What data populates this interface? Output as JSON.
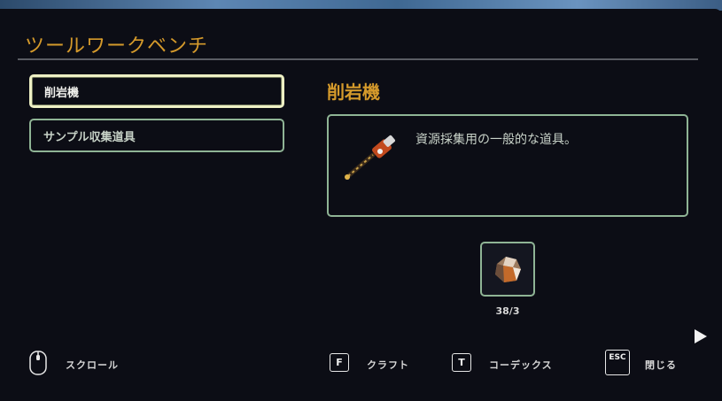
{
  "window": {
    "title": "ツールワークベンチ"
  },
  "recipes": [
    {
      "label": "削岩機"
    },
    {
      "label": "サンプル収集道具"
    }
  ],
  "details": {
    "name": "削岩機",
    "description": "資源採集用の一般的な道具。",
    "icon": "drill-icon"
  },
  "ingredients": [
    {
      "icon": "ore-icon",
      "count": "38/3"
    }
  ],
  "hints": {
    "scroll": {
      "icon": "mouse-icon",
      "label": "スクロール"
    },
    "craft": {
      "key": "F",
      "label": "クラフト"
    },
    "codex": {
      "key": "T",
      "label": "コーデックス"
    },
    "close": {
      "key": "ESC",
      "label": "閉じる"
    }
  },
  "colors": {
    "accent": "#d59a2b",
    "border": "#8fb495",
    "selected_border": "#eef0c4"
  }
}
